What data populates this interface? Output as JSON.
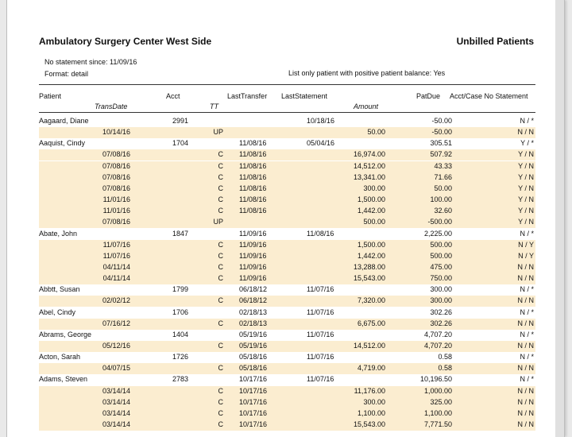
{
  "report": {
    "title": "Ambulatory Surgery Center West Side",
    "subtitle": "Unbilled Patients",
    "no_statement_since": "No statement since: 11/09/16",
    "format": "Format: detail",
    "filter": "List only patient with positive patient balance: Yes"
  },
  "columns": {
    "patient": "Patient",
    "transdate": "TransDate",
    "acct": "Acct",
    "tt": "TT",
    "lasttransfer": "LastTransfer",
    "laststatement": "LastStatement",
    "amount": "Amount",
    "patdue": "PatDue",
    "acctcase": "Acct/Case No Statement"
  },
  "rows": [
    {
      "type": "patient",
      "name": "Aagaard, Diane",
      "acct": "2991",
      "lasttransfer": "",
      "laststatement": "10/18/16",
      "patdue": "-50.00",
      "flags": "N / *"
    },
    {
      "type": "detail",
      "transdate": "10/14/16",
      "tt": "UP",
      "lasttransfer": "",
      "amount": "50.00",
      "patdue": "-50.00",
      "flags": "N / N"
    },
    {
      "type": "patient",
      "name": "Aaquist, Cindy",
      "acct": "1704",
      "lasttransfer": "11/08/16",
      "laststatement": "05/04/16",
      "patdue": "305.51",
      "flags": "Y / *"
    },
    {
      "type": "detail",
      "transdate": "07/08/16",
      "tt": "C",
      "lasttransfer": "11/08/16",
      "amount": "16,974.00",
      "patdue": "507.92",
      "flags": "Y / N"
    },
    {
      "type": "detail",
      "transdate": "07/08/16",
      "tt": "C",
      "lasttransfer": "11/08/16",
      "amount": "14,512.00",
      "patdue": "43.33",
      "flags": "Y / N"
    },
    {
      "type": "detail",
      "transdate": "07/08/16",
      "tt": "C",
      "lasttransfer": "11/08/16",
      "amount": "13,341.00",
      "patdue": "71.66",
      "flags": "Y / N"
    },
    {
      "type": "detail",
      "transdate": "07/08/16",
      "tt": "C",
      "lasttransfer": "11/08/16",
      "amount": "300.00",
      "patdue": "50.00",
      "flags": "Y / N"
    },
    {
      "type": "detail",
      "transdate": "11/01/16",
      "tt": "C",
      "lasttransfer": "11/08/16",
      "amount": "1,500.00",
      "patdue": "100.00",
      "flags": "Y / N"
    },
    {
      "type": "detail",
      "transdate": "11/01/16",
      "tt": "C",
      "lasttransfer": "11/08/16",
      "amount": "1,442.00",
      "patdue": "32.60",
      "flags": "Y / N"
    },
    {
      "type": "detail",
      "transdate": "07/08/16",
      "tt": "UP",
      "lasttransfer": "",
      "amount": "500.00",
      "patdue": "-500.00",
      "flags": "Y / N"
    },
    {
      "type": "patient",
      "name": "Abate, John",
      "acct": "1847",
      "lasttransfer": "11/09/16",
      "laststatement": "11/08/16",
      "patdue": "2,225.00",
      "flags": "N / *"
    },
    {
      "type": "detail",
      "transdate": "11/07/16",
      "tt": "C",
      "lasttransfer": "11/09/16",
      "amount": "1,500.00",
      "patdue": "500.00",
      "flags": "N / Y"
    },
    {
      "type": "detail",
      "transdate": "11/07/16",
      "tt": "C",
      "lasttransfer": "11/09/16",
      "amount": "1,442.00",
      "patdue": "500.00",
      "flags": "N / Y"
    },
    {
      "type": "detail",
      "transdate": "04/11/14",
      "tt": "C",
      "lasttransfer": "11/09/16",
      "amount": "13,288.00",
      "patdue": "475.00",
      "flags": "N / N"
    },
    {
      "type": "detail",
      "transdate": "04/11/14",
      "tt": "C",
      "lasttransfer": "11/09/16",
      "amount": "15,543.00",
      "patdue": "750.00",
      "flags": "N / N"
    },
    {
      "type": "patient",
      "name": "Abbtt, Susan",
      "acct": "1799",
      "lasttransfer": "06/18/12",
      "laststatement": "11/07/16",
      "patdue": "300.00",
      "flags": "N / *"
    },
    {
      "type": "detail",
      "transdate": "02/02/12",
      "tt": "C",
      "lasttransfer": "06/18/12",
      "amount": "7,320.00",
      "patdue": "300.00",
      "flags": "N / N"
    },
    {
      "type": "patient",
      "name": "Abel, Cindy",
      "acct": "1706",
      "lasttransfer": "02/18/13",
      "laststatement": "11/07/16",
      "patdue": "302.26",
      "flags": "N / *"
    },
    {
      "type": "detail",
      "transdate": "07/16/12",
      "tt": "C",
      "lasttransfer": "02/18/13",
      "amount": "6,675.00",
      "patdue": "302.26",
      "flags": "N / N"
    },
    {
      "type": "patient",
      "name": "Abrams, George",
      "acct": "1404",
      "lasttransfer": "05/19/16",
      "laststatement": "11/07/16",
      "patdue": "4,707.20",
      "flags": "N / *"
    },
    {
      "type": "detail",
      "transdate": "05/12/16",
      "tt": "C",
      "lasttransfer": "05/19/16",
      "amount": "14,512.00",
      "patdue": "4,707.20",
      "flags": "N / N"
    },
    {
      "type": "patient",
      "name": "Acton, Sarah",
      "acct": "1726",
      "lasttransfer": "05/18/16",
      "laststatement": "11/07/16",
      "patdue": "0.58",
      "flags": "N / *"
    },
    {
      "type": "detail",
      "transdate": "04/07/15",
      "tt": "C",
      "lasttransfer": "05/18/16",
      "amount": "4,719.00",
      "patdue": "0.58",
      "flags": "N / N"
    },
    {
      "type": "patient",
      "name": "Adams, Steven",
      "acct": "2783",
      "lasttransfer": "10/17/16",
      "laststatement": "11/07/16",
      "patdue": "10,196.50",
      "flags": "N / *"
    },
    {
      "type": "detail",
      "transdate": "03/14/14",
      "tt": "C",
      "lasttransfer": "10/17/16",
      "amount": "11,176.00",
      "patdue": "1,000.00",
      "flags": "N / N"
    },
    {
      "type": "detail",
      "transdate": "03/14/14",
      "tt": "C",
      "lasttransfer": "10/17/16",
      "amount": "300.00",
      "patdue": "325.00",
      "flags": "N / N"
    },
    {
      "type": "detail",
      "transdate": "03/14/14",
      "tt": "C",
      "lasttransfer": "10/17/16",
      "amount": "1,100.00",
      "patdue": "1,100.00",
      "flags": "N / N"
    },
    {
      "type": "detail",
      "transdate": "03/14/14",
      "tt": "C",
      "lasttransfer": "10/17/16",
      "amount": "15,543.00",
      "patdue": "7,771.50",
      "flags": "N / N"
    }
  ]
}
